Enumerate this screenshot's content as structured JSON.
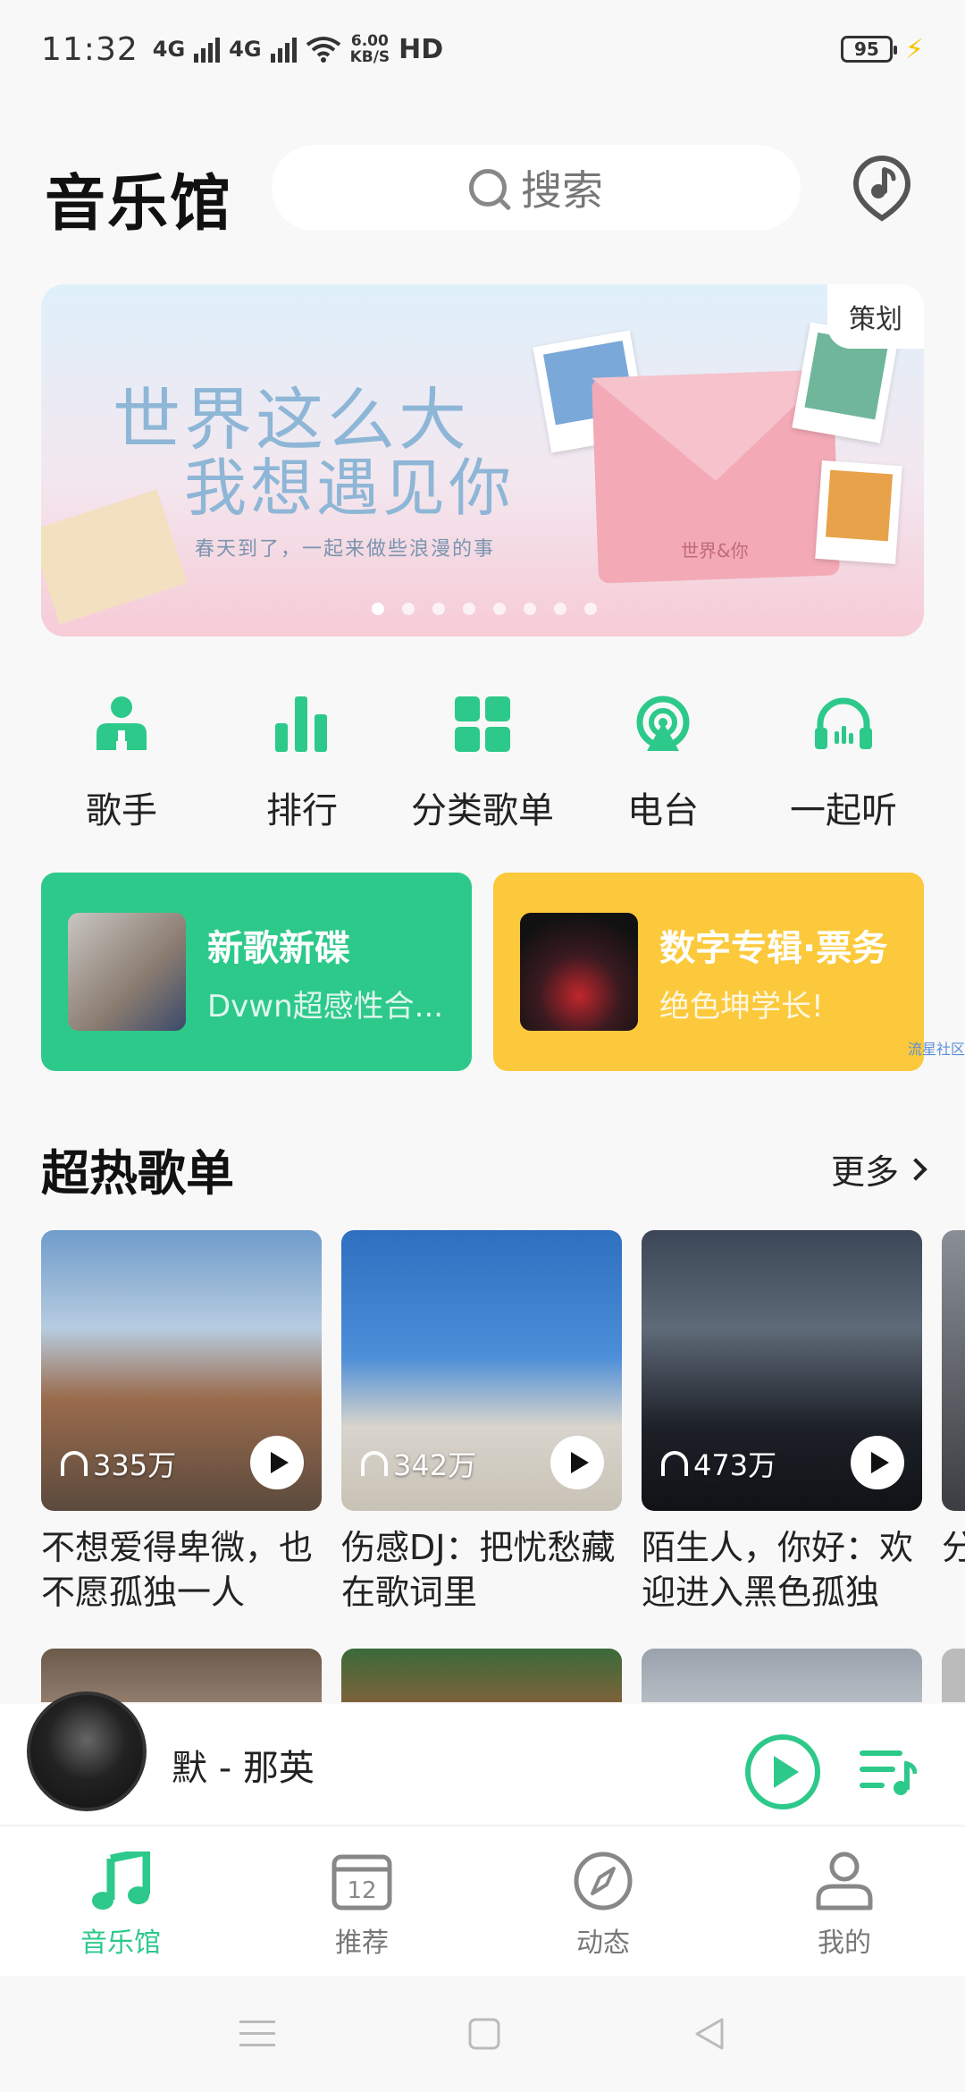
{
  "status": {
    "time": "11:32",
    "net1": "4G",
    "net2": "4G",
    "speed_value": "6.00",
    "speed_unit": "KB/S",
    "hd": "HD",
    "battery": "95"
  },
  "header": {
    "title": "音乐馆",
    "search_placeholder": "搜索",
    "recognize_icon": "music-recognize-icon"
  },
  "banner": {
    "tag": "策划",
    "title_line1": "世界这么大",
    "title_line2": "我想遇见你",
    "subtitle": "春天到了，一起来做些浪漫的事",
    "envelope_label": "世界&你",
    "page_count": 8,
    "active_page": 0
  },
  "shortcuts": [
    {
      "label": "歌手",
      "icon": "singer-icon"
    },
    {
      "label": "排行",
      "icon": "chart-icon"
    },
    {
      "label": "分类歌单",
      "icon": "category-icon"
    },
    {
      "label": "电台",
      "icon": "radio-icon"
    },
    {
      "label": "一起听",
      "icon": "listen-together-icon"
    }
  ],
  "feature_cards": [
    {
      "title": "新歌新碟",
      "subtitle": "Dvwn超感性合..."
    },
    {
      "title": "数字专辑·票务",
      "subtitle": "绝色坤学长!"
    }
  ],
  "watermark": "流星社区",
  "section": {
    "title": "超热歌单",
    "more_label": "更多"
  },
  "playlists": [
    {
      "count": "335万",
      "name": "不想爱得卑微，也不愿孤独一人"
    },
    {
      "count": "342万",
      "name": "伤感DJ：把忧愁藏在歌词里"
    },
    {
      "count": "473万",
      "name": "陌生人，你好：欢迎进入黑色孤独"
    },
    {
      "count": "",
      "name": "分乌"
    }
  ],
  "player": {
    "song": "默 - 那英"
  },
  "tabs": [
    {
      "label": "音乐馆",
      "active": true,
      "icon": "music-note-icon"
    },
    {
      "label": "推荐",
      "active": false,
      "icon": "calendar-icon",
      "calendar_day": "12"
    },
    {
      "label": "动态",
      "active": false,
      "icon": "compass-icon"
    },
    {
      "label": "我的",
      "active": false,
      "icon": "user-icon"
    }
  ],
  "accent_color": "#2dc98a"
}
